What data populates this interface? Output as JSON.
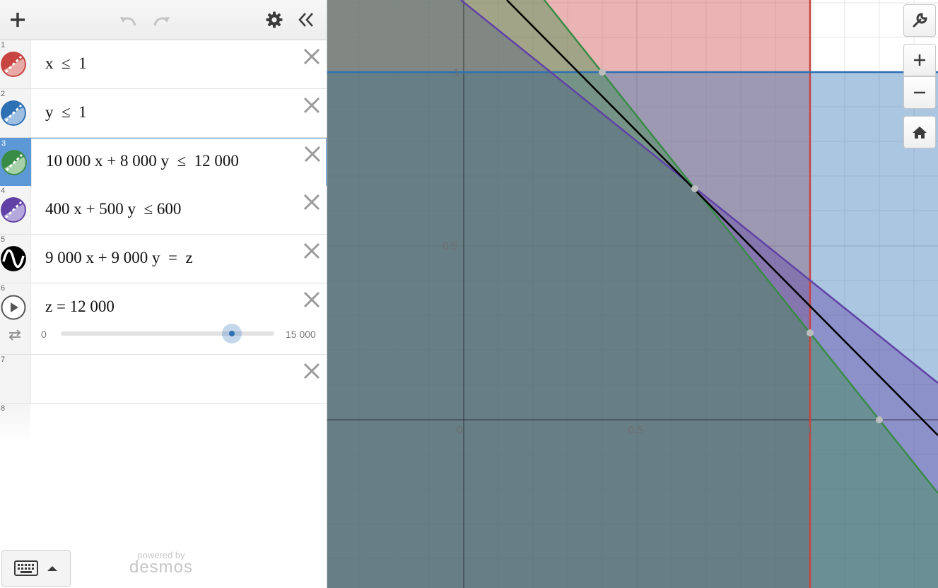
{
  "app": "Desmos Graphing Calculator",
  "toolbar": {
    "add": "add-expression",
    "undo": "undo",
    "redo": "redo",
    "settings": "gear-icon",
    "collapse": "collapse-list"
  },
  "expressions": [
    {
      "num": "1",
      "latex": "x  ≤  1",
      "color": "#c74440",
      "kind": "inequality"
    },
    {
      "num": "2",
      "latex": "y  ≤  1",
      "color": "#2d70b3",
      "kind": "inequality"
    },
    {
      "num": "3",
      "latex": "10 000 x + 8 000 y  ≤  12 000",
      "color": "#388c46",
      "kind": "inequality",
      "selected": true
    },
    {
      "num": "4",
      "latex": "400 x + 500 y  ≤ 600",
      "color": "#6042a6",
      "kind": "inequality"
    },
    {
      "num": "5",
      "latex": "9 000 x + 9 000 y  =  z",
      "color": "#000000",
      "kind": "line"
    },
    {
      "num": "6",
      "latex": "z = 12 000",
      "kind": "slider",
      "slider": {
        "min": "0",
        "max": "15 000",
        "value": 12000
      }
    },
    {
      "num": "7",
      "latex": ""
    },
    {
      "num": "8",
      "latex": ""
    }
  ],
  "graph": {
    "x_tick_labels": [
      "0",
      "0.5",
      "1"
    ],
    "y_tick_labels": [
      "0.5",
      "1"
    ],
    "colors": {
      "red": "#c74440",
      "blue": "#2d70b3",
      "green": "#388c46",
      "purple": "#6042a6",
      "black": "#000000"
    }
  },
  "footer": {
    "powered_by": "powered by",
    "brand": "desmos"
  },
  "graph_controls": [
    "wrench-icon",
    "zoom-in",
    "zoom-out",
    "home-icon"
  ]
}
